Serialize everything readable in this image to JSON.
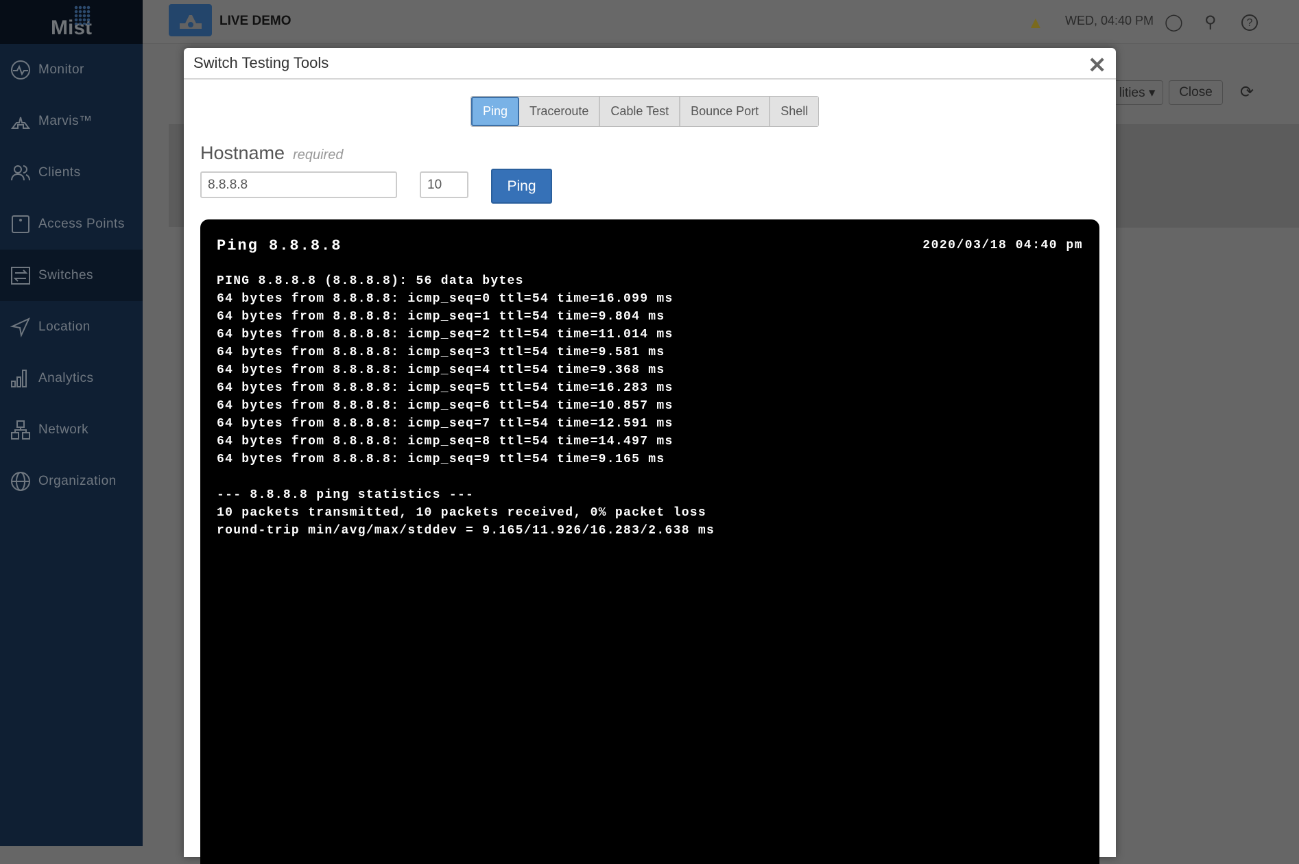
{
  "sidebar": {
    "logo": "Mist",
    "items": [
      {
        "label": "Monitor"
      },
      {
        "label": "Marvis™"
      },
      {
        "label": "Clients"
      },
      {
        "label": "Access Points"
      },
      {
        "label": "Switches"
      },
      {
        "label": "Location"
      },
      {
        "label": "Analytics"
      },
      {
        "label": "Network"
      },
      {
        "label": "Organization"
      }
    ]
  },
  "header": {
    "org": "LIVE DEMO",
    "time": "WED, 04:40 PM"
  },
  "background": {
    "utilities": "lities ▾",
    "close": "Close"
  },
  "modal": {
    "title": "Switch Testing Tools",
    "tabs": [
      {
        "label": "Ping"
      },
      {
        "label": "Traceroute"
      },
      {
        "label": "Cable Test"
      },
      {
        "label": "Bounce Port"
      },
      {
        "label": "Shell"
      }
    ],
    "hostname_label": "Hostname",
    "required": "required",
    "hostname_value": "8.8.8.8",
    "count_value": "10",
    "ping_button": "Ping",
    "terminal": {
      "title": "Ping 8.8.8.8",
      "date": "2020/03/18 04:40 pm",
      "lines": [
        "PING 8.8.8.8 (8.8.8.8): 56 data bytes",
        "64 bytes from 8.8.8.8: icmp_seq=0 ttl=54 time=16.099 ms",
        "64 bytes from 8.8.8.8: icmp_seq=1 ttl=54 time=9.804 ms",
        "64 bytes from 8.8.8.8: icmp_seq=2 ttl=54 time=11.014 ms",
        "64 bytes from 8.8.8.8: icmp_seq=3 ttl=54 time=9.581 ms",
        "64 bytes from 8.8.8.8: icmp_seq=4 ttl=54 time=9.368 ms",
        "64 bytes from 8.8.8.8: icmp_seq=5 ttl=54 time=16.283 ms",
        "64 bytes from 8.8.8.8: icmp_seq=6 ttl=54 time=10.857 ms",
        "64 bytes from 8.8.8.8: icmp_seq=7 ttl=54 time=12.591 ms",
        "64 bytes from 8.8.8.8: icmp_seq=8 ttl=54 time=14.497 ms",
        "64 bytes from 8.8.8.8: icmp_seq=9 ttl=54 time=9.165 ms",
        "",
        "--- 8.8.8.8 ping statistics ---",
        "10 packets transmitted, 10 packets received, 0% packet loss",
        "round-trip min/avg/max/stddev = 9.165/11.926/16.283/2.638 ms"
      ]
    }
  }
}
